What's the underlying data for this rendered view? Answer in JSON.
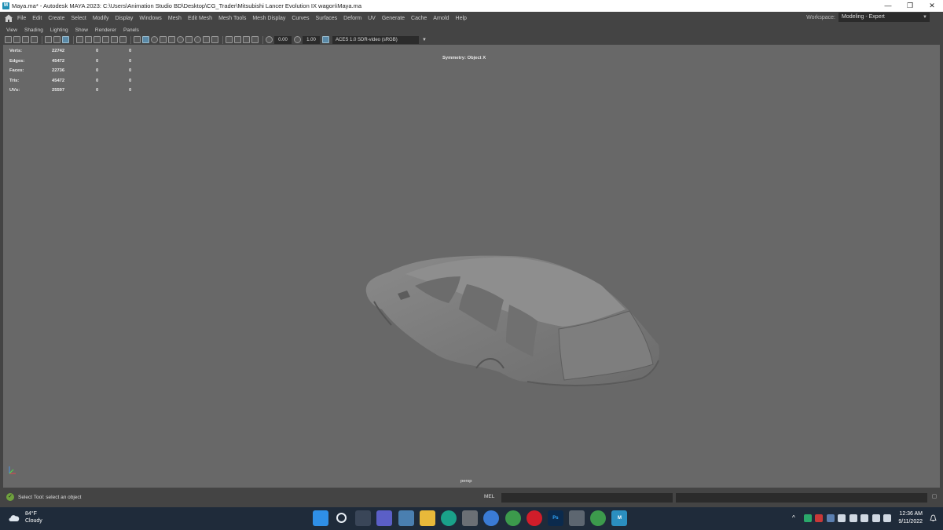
{
  "window": {
    "title": "Maya.ma* - Autodesk MAYA 2023: C:\\Users\\Animation Studio BD\\Desktop\\CG_Trader\\Mitsubishi Lancer Evolution IX wagon\\Maya.ma",
    "app_icon_letter": "M",
    "minimize": "—",
    "restore": "❐",
    "close": "✕"
  },
  "menubar": {
    "items": [
      "File",
      "Edit",
      "Create",
      "Select",
      "Modify",
      "Display",
      "Windows",
      "Mesh",
      "Edit Mesh",
      "Mesh Tools",
      "Mesh Display",
      "Curves",
      "Surfaces",
      "Deform",
      "UV",
      "Generate",
      "Cache",
      "Arnold",
      "Help"
    ],
    "workspace_label": "Workspace:",
    "workspace_value": "Modeling - Expert"
  },
  "panel_menu": {
    "items": [
      "View",
      "Shading",
      "Lighting",
      "Show",
      "Renderer",
      "Panels"
    ]
  },
  "toolbar": {
    "exposure": "0.00",
    "gamma": "1.00",
    "color_space": "ACES 1.0 SDR-video (sRGB)"
  },
  "viewport": {
    "hud": {
      "rows": [
        {
          "label": "Verts:",
          "v1": "22742",
          "v2": "0",
          "v3": "0"
        },
        {
          "label": "Edges:",
          "v1": "45472",
          "v2": "0",
          "v3": "0"
        },
        {
          "label": "Faces:",
          "v1": "22736",
          "v2": "0",
          "v3": "0"
        },
        {
          "label": "Tris:",
          "v1": "45472",
          "v2": "0",
          "v3": "0"
        },
        {
          "label": "UVs:",
          "v1": "25597",
          "v2": "0",
          "v3": "0"
        }
      ]
    },
    "symmetry": "Symmetry: Object X",
    "camera": "persp"
  },
  "status": {
    "help_line": "Select Tool: select an object",
    "mel_label": "MEL"
  },
  "taskbar": {
    "temperature": "84°F",
    "weather": "Cloudy",
    "time": "12:36 AM",
    "date": "9/11/2022",
    "apps": [
      {
        "name": "start",
        "color": "#2f8fe6",
        "label": ""
      },
      {
        "name": "search",
        "color": "#1f2b3a",
        "label": ""
      },
      {
        "name": "task-view",
        "color": "#1f2b3a",
        "label": ""
      },
      {
        "name": "chat",
        "color": "#5b5fc7",
        "label": ""
      },
      {
        "name": "photos",
        "color": "#4a7fb0",
        "label": ""
      },
      {
        "name": "file-explorer",
        "color": "#e8b93a",
        "label": ""
      },
      {
        "name": "edge",
        "color": "#1aa18a",
        "label": ""
      },
      {
        "name": "store",
        "color": "#6b6f75",
        "label": ""
      },
      {
        "name": "settings-app",
        "color": "#3a7bd5",
        "label": ""
      },
      {
        "name": "chrome",
        "color": "#3c9a4c",
        "label": ""
      },
      {
        "name": "opera",
        "color": "#d11d2a",
        "label": ""
      },
      {
        "name": "photoshop",
        "color": "#0b2a4d",
        "label": "Ps"
      },
      {
        "name": "calculator",
        "color": "#5d6670",
        "label": ""
      },
      {
        "name": "chrome-profile",
        "color": "#3c9a4c",
        "label": ""
      },
      {
        "name": "maya",
        "color": "#2b8fc0",
        "label": "M"
      }
    ]
  }
}
